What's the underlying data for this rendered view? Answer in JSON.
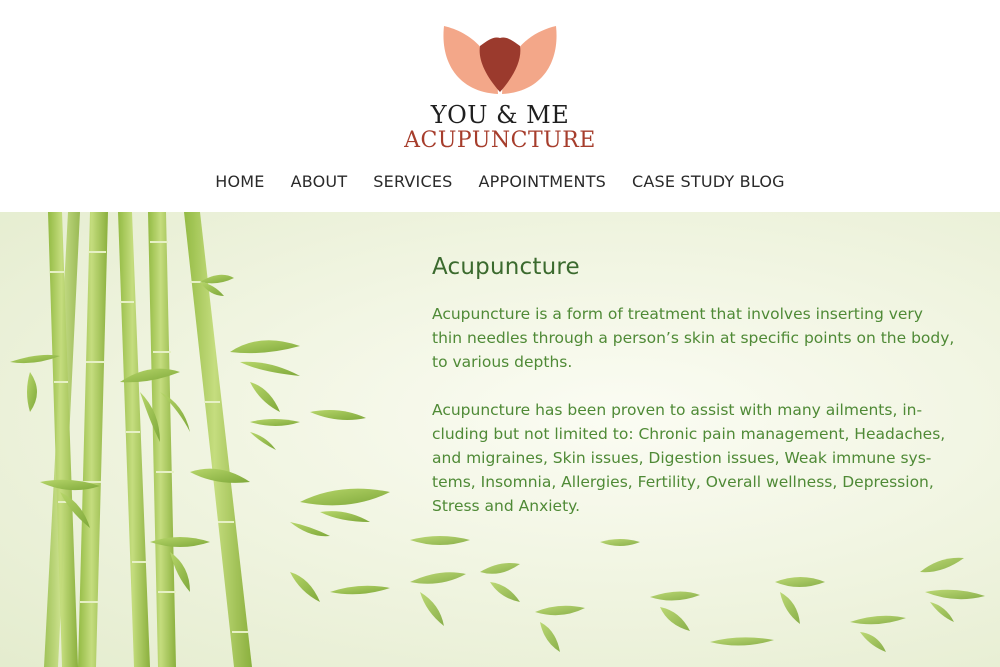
{
  "brand": {
    "line1": "YOU & ME",
    "line2": "ACUPUNCTURE",
    "colors": {
      "petal": "#f3a789",
      "center": "#9b3a2d",
      "text": "#1f1f1f",
      "accent": "#a63d2c"
    }
  },
  "nav": {
    "items": [
      {
        "label": "HOME"
      },
      {
        "label": "ABOUT"
      },
      {
        "label": "SERVICES"
      },
      {
        "label": "APPOINTMENTS"
      },
      {
        "label": "CASE STUDY BLOG"
      }
    ]
  },
  "main": {
    "title": "Acupuncture",
    "paragraphs": [
      "Acupuncture is a form of treatment that involves inserting very thin needles through a person’s skin at specific points on the body, to various depths.",
      "Acupuncture has been proven to assist with many ailments, in-cluding but not limited to: Chronic pain management, Headaches, and migraines, Skin issues, Digestion issues, Weak immune sys-tems, Insomnia, Allergies, Fertility, Overall wellness, Depression, Stress and Anxiety."
    ]
  },
  "theme": {
    "background": "#eef3dd",
    "heading_color": "#3b6a2e",
    "text_color": "#4f8a36",
    "bamboo": "#9ac04a"
  }
}
